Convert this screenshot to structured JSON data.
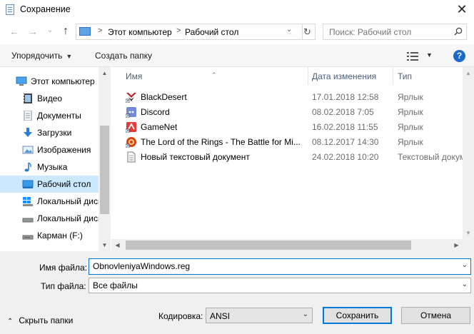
{
  "window": {
    "title": "Сохранение",
    "close_glyph": "✕"
  },
  "nav": {
    "back_glyph": "←",
    "forward_glyph": "→",
    "recent_glyph": "⌄",
    "up_glyph": "↑",
    "breadcrumb": [
      "Этот компьютер",
      "Рабочий стол"
    ],
    "breadcrumb_sep": ">",
    "search_placeholder": "Поиск: Рабочий стол"
  },
  "toolbar": {
    "organize_label": "Упорядочить",
    "new_folder_label": "Создать папку",
    "help_label": "?"
  },
  "sidebar": {
    "items": [
      {
        "label": "Этот компьютер",
        "icon": "computer-icon",
        "level": "top"
      },
      {
        "label": "Видео",
        "icon": "video-icon"
      },
      {
        "label": "Документы",
        "icon": "documents-icon"
      },
      {
        "label": "Загрузки",
        "icon": "downloads-icon"
      },
      {
        "label": "Изображения",
        "icon": "pictures-icon"
      },
      {
        "label": "Музыка",
        "icon": "music-icon"
      },
      {
        "label": "Рабочий стол",
        "icon": "desktop-icon",
        "selected": true
      },
      {
        "label": "Локальный диск",
        "icon": "windows-drive-icon"
      },
      {
        "label": "Локальный диск",
        "icon": "drive-icon"
      },
      {
        "label": "Карман (F:)",
        "icon": "usb-drive-icon"
      }
    ]
  },
  "filelist": {
    "columns": [
      "Имя",
      "Дата изменения",
      "Тип"
    ],
    "rows": [
      {
        "name": "BlackDesert",
        "date": "17.01.2018 12:58",
        "type": "Ярлык",
        "icon": "blackdesert-shortcut-icon"
      },
      {
        "name": "Discord",
        "date": "08.02.2018 7:05",
        "type": "Ярлык",
        "icon": "discord-shortcut-icon"
      },
      {
        "name": "GameNet",
        "date": "16.02.2018 11:55",
        "type": "Ярлык",
        "icon": "gamenet-shortcut-icon"
      },
      {
        "name": "The Lord of the Rings - The Battle for Mi...",
        "date": "08.12.2017 14:30",
        "type": "Ярлык",
        "icon": "lotr-shortcut-icon"
      },
      {
        "name": "Новый текстовый документ",
        "date": "24.02.2018 10:20",
        "type": "Текстовый докум",
        "icon": "text-document-icon"
      }
    ]
  },
  "form": {
    "filename_label": "Имя файла:",
    "filename_value": "ObnovleniyaWindows.reg",
    "filetype_label": "Тип файла:",
    "filetype_value": "Все файлы",
    "encoding_label": "Кодировка:",
    "encoding_value": "ANSI",
    "hide_folders_label": "Скрыть папки",
    "save_label": "Сохранить",
    "cancel_label": "Отмена"
  },
  "colors": {
    "accent": "#0078d7",
    "selection": "#cce8ff",
    "help": "#1b6ac9"
  }
}
